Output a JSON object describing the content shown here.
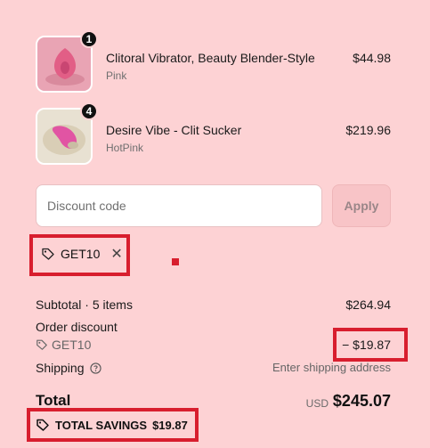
{
  "items": [
    {
      "name": "Clitoral Vibrator, Beauty Blender-Style",
      "variant": "Pink",
      "price": "$44.98",
      "qty": "1"
    },
    {
      "name": "Desire Vibe - Clit Sucker",
      "variant": "HotPink",
      "price": "$219.96",
      "qty": "4"
    }
  ],
  "discount": {
    "placeholder": "Discount code",
    "apply_label": "Apply",
    "applied_code": "GET10"
  },
  "summary": {
    "subtotal_label": "Subtotal · 5 items",
    "subtotal_value": "$264.94",
    "order_discount_label": "Order discount",
    "order_discount_code": "GET10",
    "order_discount_value": "− $19.87",
    "shipping_label": "Shipping",
    "shipping_value": "Enter shipping address",
    "total_label": "Total",
    "currency": "USD",
    "total_value": "$245.07",
    "savings_label": "TOTAL SAVINGS",
    "savings_value": "$19.87"
  },
  "colors": {
    "background": "#fdd2d4",
    "highlight": "#d81e2e"
  },
  "icons": [
    "tag-icon",
    "close-icon",
    "help-circle-icon"
  ]
}
